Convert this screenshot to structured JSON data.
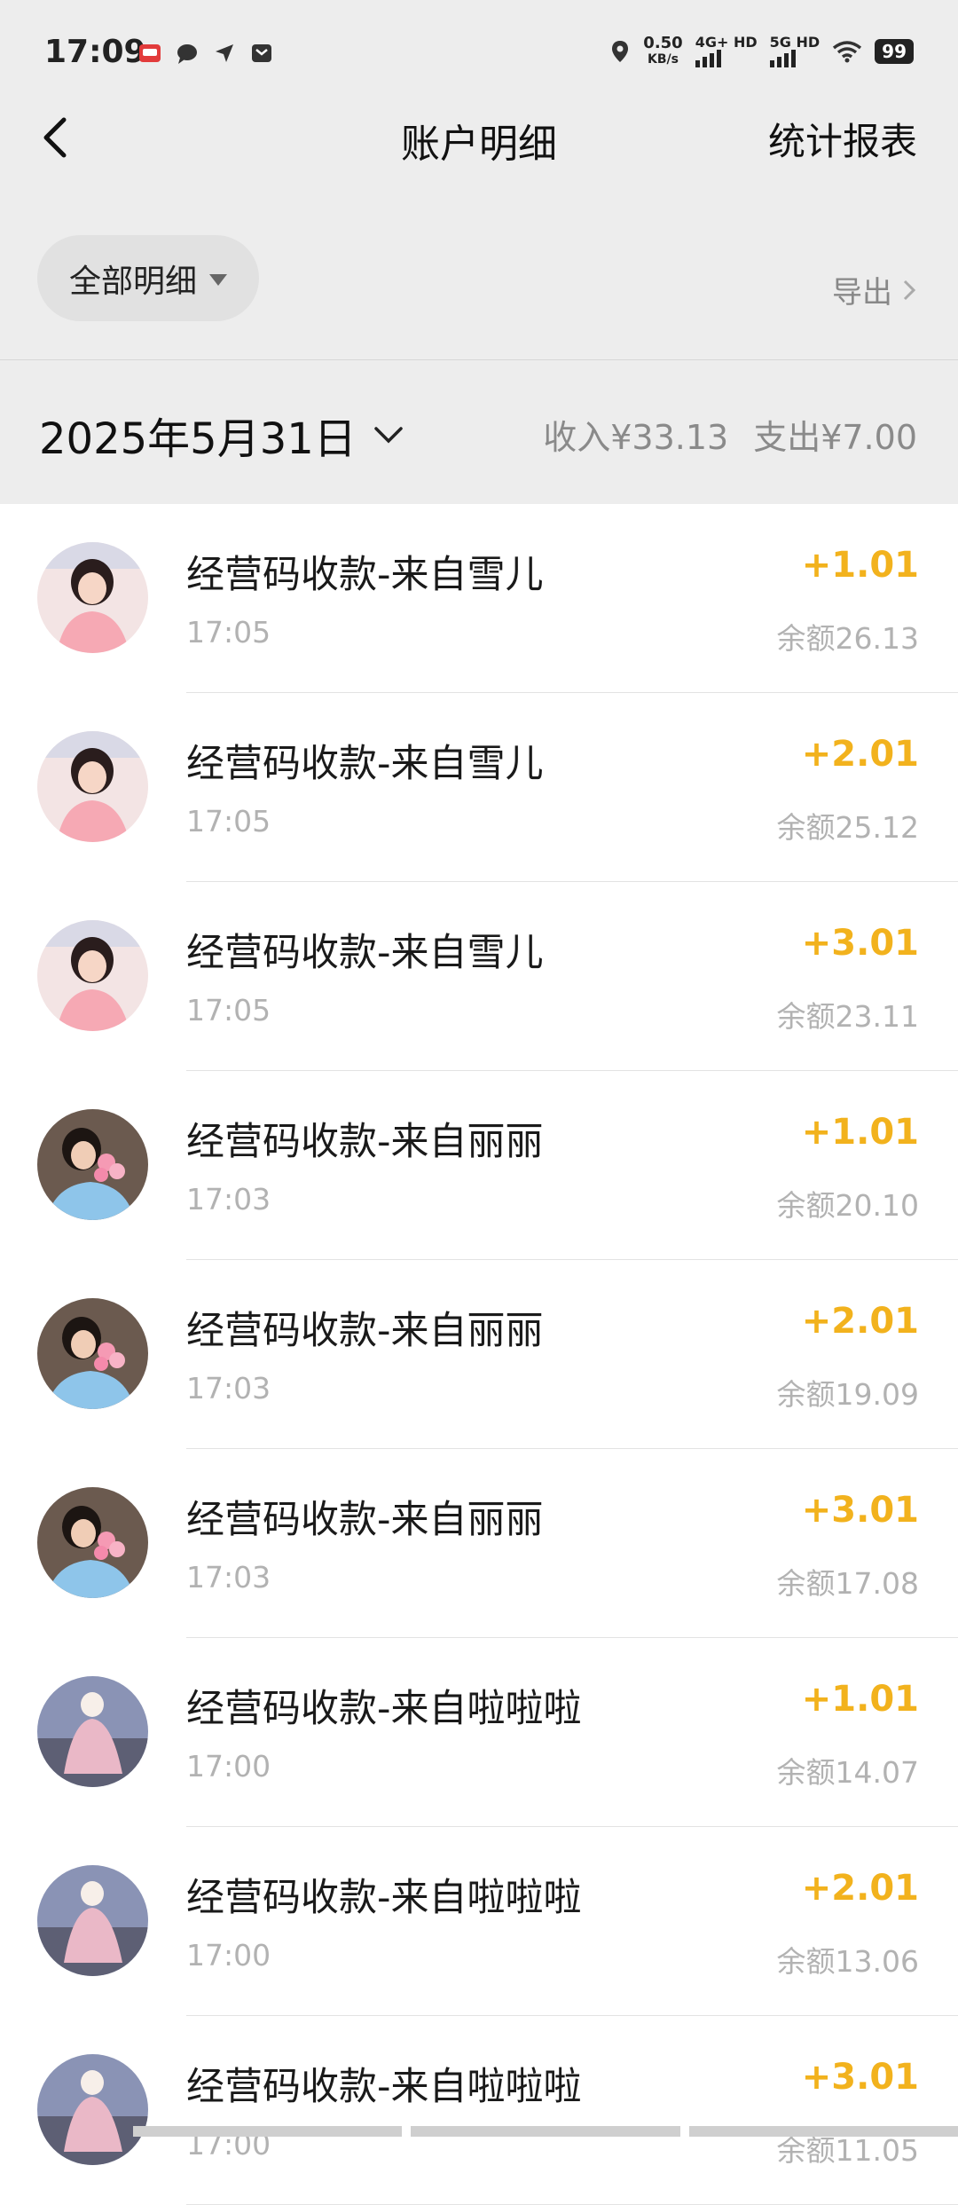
{
  "status_bar": {
    "time": "17:09",
    "net_speed_value": "0.50",
    "net_speed_unit": "KB/s",
    "sim1_label": "4G+ HD",
    "sim2_label": "5G HD",
    "battery": "99"
  },
  "header": {
    "title": "账户明细",
    "report_label": "统计报表"
  },
  "filter": {
    "label": "全部明细",
    "export_label": "导出"
  },
  "date_bar": {
    "date": "2025年5月31日",
    "income": "收入¥33.13",
    "expense": "支出¥7.00"
  },
  "colors": {
    "accent_income": "#f2b21d",
    "background": "#ededed"
  },
  "transactions": [
    {
      "title": "经营码收款-来自雪儿",
      "time": "17:05",
      "amount": "+1.01",
      "balance": "余额26.13",
      "avatar": "girl-pink-avatar"
    },
    {
      "title": "经营码收款-来自雪儿",
      "time": "17:05",
      "amount": "+2.01",
      "balance": "余额25.12",
      "avatar": "girl-pink-avatar"
    },
    {
      "title": "经营码收款-来自雪儿",
      "time": "17:05",
      "amount": "+3.01",
      "balance": "余额23.11",
      "avatar": "girl-pink-avatar"
    },
    {
      "title": "经营码收款-来自丽丽",
      "time": "17:03",
      "amount": "+1.01",
      "balance": "余额20.10",
      "avatar": "girl-flowers-avatar"
    },
    {
      "title": "经营码收款-来自丽丽",
      "time": "17:03",
      "amount": "+2.01",
      "balance": "余额19.09",
      "avatar": "girl-flowers-avatar"
    },
    {
      "title": "经营码收款-来自丽丽",
      "time": "17:03",
      "amount": "+3.01",
      "balance": "余额17.08",
      "avatar": "girl-flowers-avatar"
    },
    {
      "title": "经营码收款-来自啦啦啦",
      "time": "17:00",
      "amount": "+1.01",
      "balance": "余额14.07",
      "avatar": "girl-dress-avatar"
    },
    {
      "title": "经营码收款-来自啦啦啦",
      "time": "17:00",
      "amount": "+2.01",
      "balance": "余额13.06",
      "avatar": "girl-dress-avatar"
    },
    {
      "title": "经营码收款-来自啦啦啦",
      "time": "17:00",
      "amount": "+3.01",
      "balance": "余额11.05",
      "avatar": "girl-dress-avatar"
    }
  ]
}
